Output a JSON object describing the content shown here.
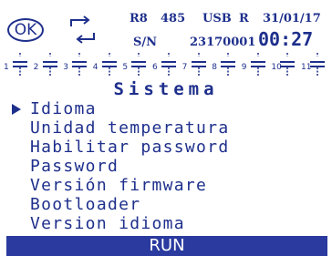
{
  "status": {
    "ok_label": "OK",
    "r8": "R8",
    "rs485": "485",
    "usb": "USB",
    "r": "R",
    "date": "31/01/17",
    "sn_label": "S/N",
    "serial": "23170001",
    "time": "00:27"
  },
  "channels": [
    {
      "num": "1"
    },
    {
      "num": "2"
    },
    {
      "num": "3"
    },
    {
      "num": "4"
    },
    {
      "num": "5"
    },
    {
      "num": "6"
    },
    {
      "num": "7"
    },
    {
      "num": "8"
    },
    {
      "num": "9"
    },
    {
      "num": "10"
    },
    {
      "num": "11"
    }
  ],
  "screen_title": "Sistema",
  "menu": {
    "selected_index": 0,
    "items": [
      {
        "label": "Idioma"
      },
      {
        "label": "Unidad temperatura"
      },
      {
        "label": "Habilitar password"
      },
      {
        "label": "Password"
      },
      {
        "label": "Versión firmware"
      },
      {
        "label": "Bootloader"
      },
      {
        "label": "Version idioma"
      }
    ]
  },
  "run_bar": {
    "label": "RUN"
  },
  "colors": {
    "foreground": "#1e2f8c",
    "run_bar": "#2a3a9e",
    "background": "#ffffff"
  }
}
